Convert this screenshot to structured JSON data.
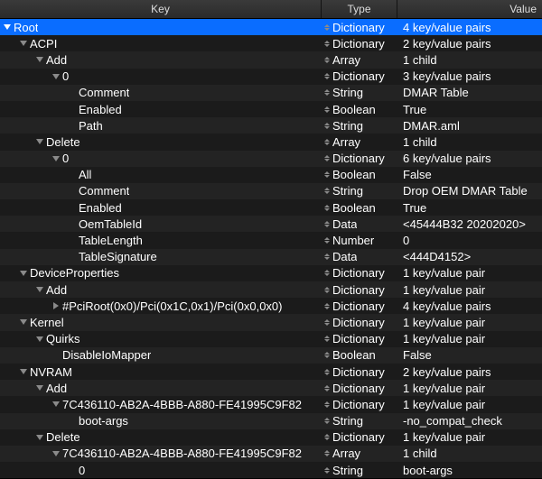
{
  "header": {
    "key": "Key",
    "type": "Type",
    "value": "Value"
  },
  "rows": [
    {
      "depth": 0,
      "disclosure": "down",
      "key": "Root",
      "type": "Dictionary",
      "value": "4 key/value pairs",
      "selected": true
    },
    {
      "depth": 1,
      "disclosure": "down",
      "key": "ACPI",
      "type": "Dictionary",
      "value": "2 key/value pairs"
    },
    {
      "depth": 2,
      "disclosure": "down",
      "key": "Add",
      "type": "Array",
      "value": "1 child"
    },
    {
      "depth": 3,
      "disclosure": "down",
      "key": "0",
      "type": "Dictionary",
      "value": "3 key/value pairs"
    },
    {
      "depth": 4,
      "disclosure": "none",
      "key": "Comment",
      "type": "String",
      "value": "DMAR Table"
    },
    {
      "depth": 4,
      "disclosure": "none",
      "key": "Enabled",
      "type": "Boolean",
      "value": "True"
    },
    {
      "depth": 4,
      "disclosure": "none",
      "key": "Path",
      "type": "String",
      "value": "DMAR.aml"
    },
    {
      "depth": 2,
      "disclosure": "down",
      "key": "Delete",
      "type": "Array",
      "value": "1 child"
    },
    {
      "depth": 3,
      "disclosure": "down",
      "key": "0",
      "type": "Dictionary",
      "value": "6 key/value pairs"
    },
    {
      "depth": 4,
      "disclosure": "none",
      "key": "All",
      "type": "Boolean",
      "value": "False"
    },
    {
      "depth": 4,
      "disclosure": "none",
      "key": "Comment",
      "type": "String",
      "value": "Drop OEM DMAR Table"
    },
    {
      "depth": 4,
      "disclosure": "none",
      "key": "Enabled",
      "type": "Boolean",
      "value": "True"
    },
    {
      "depth": 4,
      "disclosure": "none",
      "key": "OemTableId",
      "type": "Data",
      "value": "<45444B32 20202020>"
    },
    {
      "depth": 4,
      "disclosure": "none",
      "key": "TableLength",
      "type": "Number",
      "value": "0"
    },
    {
      "depth": 4,
      "disclosure": "none",
      "key": "TableSignature",
      "type": "Data",
      "value": "<444D4152>"
    },
    {
      "depth": 1,
      "disclosure": "down",
      "key": "DeviceProperties",
      "type": "Dictionary",
      "value": "1 key/value pair"
    },
    {
      "depth": 2,
      "disclosure": "down",
      "key": "Add",
      "type": "Dictionary",
      "value": "1 key/value pair"
    },
    {
      "depth": 3,
      "disclosure": "right",
      "key": "#PciRoot(0x0)/Pci(0x1C,0x1)/Pci(0x0,0x0)",
      "type": "Dictionary",
      "value": "4 key/value pairs"
    },
    {
      "depth": 1,
      "disclosure": "down",
      "key": "Kernel",
      "type": "Dictionary",
      "value": "1 key/value pair"
    },
    {
      "depth": 2,
      "disclosure": "down",
      "key": "Quirks",
      "type": "Dictionary",
      "value": "1 key/value pair"
    },
    {
      "depth": 3,
      "disclosure": "none",
      "key": "DisableIoMapper",
      "type": "Boolean",
      "value": "False"
    },
    {
      "depth": 1,
      "disclosure": "down",
      "key": "NVRAM",
      "type": "Dictionary",
      "value": "2 key/value pairs"
    },
    {
      "depth": 2,
      "disclosure": "down",
      "key": "Add",
      "type": "Dictionary",
      "value": "1 key/value pair"
    },
    {
      "depth": 3,
      "disclosure": "down",
      "key": "7C436110-AB2A-4BBB-A880-FE41995C9F82",
      "type": "Dictionary",
      "value": "1 key/value pair"
    },
    {
      "depth": 4,
      "disclosure": "none",
      "key": "boot-args",
      "type": "String",
      "value": "-no_compat_check"
    },
    {
      "depth": 2,
      "disclosure": "down",
      "key": "Delete",
      "type": "Dictionary",
      "value": "1 key/value pair"
    },
    {
      "depth": 3,
      "disclosure": "down",
      "key": "7C436110-AB2A-4BBB-A880-FE41995C9F82",
      "type": "Array",
      "value": "1 child"
    },
    {
      "depth": 4,
      "disclosure": "none",
      "key": "0",
      "type": "String",
      "value": "boot-args"
    }
  ]
}
